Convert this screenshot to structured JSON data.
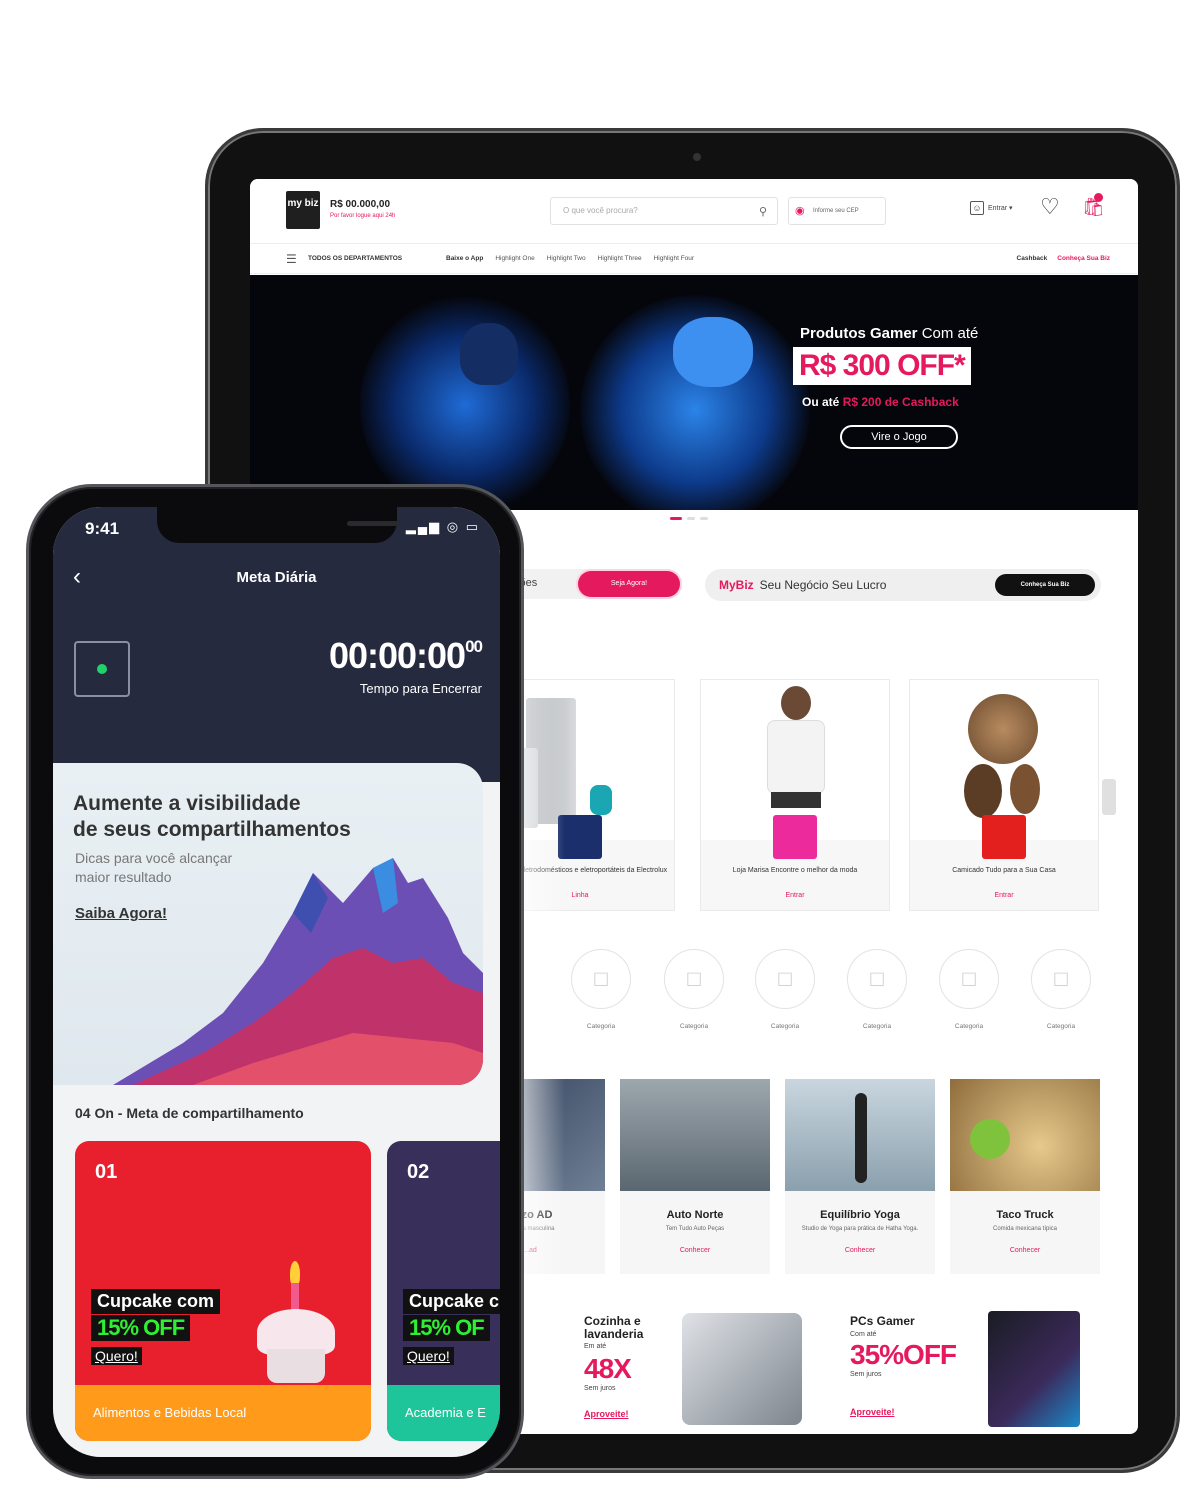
{
  "tablet": {
    "header": {
      "logo": "my biz",
      "balance": "R$ 00.000,00",
      "balance_sub": "Por favor logue aqui 24h",
      "search_placeholder": "O que você procura?",
      "cep": "Informe seu CEP",
      "user": "Entrar",
      "cart_count": "0"
    },
    "nav": {
      "all_departments": "TODOS OS DEPARTAMENTOS",
      "links": [
        "Baixe o App",
        "Highlight One",
        "Highlight Two",
        "Highlight Three",
        "Highlight Four"
      ],
      "right": [
        "Cashback",
        "Conheça Sua Biz"
      ]
    },
    "hero": {
      "headline_bold": "Produtos Gamer",
      "headline_rest": " Com até",
      "price": "R$ 300 OFF*",
      "sub_prefix": "Ou até ",
      "sub_highlight": "R$ 200 de Cashback",
      "cta": "Vire o Jogo"
    },
    "pills": {
      "left": "ções",
      "active": "Seja Agora!"
    },
    "promo": {
      "brand": "MyBiz",
      "text": "Seu Negócio Seu Lucro",
      "button": "Conheça Sua Biz"
    },
    "stores": [
      {
        "title": "Escolha eletrodomésticos e eletroportáteis da Electrolux",
        "link": "Linha"
      },
      {
        "title": "Loja Marisa Encontre o melhor da moda",
        "link": "Entrar"
      },
      {
        "title": "Camicado Tudo para a Sua Casa",
        "link": "Entrar"
      }
    ],
    "categories": [
      "Categoria",
      "Categoria",
      "Categoria",
      "Categoria",
      "Categoria",
      "Categoria"
    ],
    "businesses": [
      {
        "title": "Enzo AD",
        "desc": "...roupa masculina",
        "link": "...ad"
      },
      {
        "title": "Auto Norte",
        "desc": "Tem Tudo Auto Peças",
        "link": "Conhecer"
      },
      {
        "title": "Equilíbrio Yoga",
        "desc": "Studio de Yoga para prática de Hatha Yoga.",
        "link": "Conhecer"
      },
      {
        "title": "Taco Truck",
        "desc": "Comida mexicana típica",
        "link": "Conhecer"
      }
    ],
    "ads": [
      {
        "title": "Cozinha e lavanderia",
        "small": "Em até",
        "big": "48X",
        "small2": "Sem juros",
        "link": "Aproveite!"
      },
      {
        "title": "PCs Gamer",
        "small": "Com até",
        "big": "35%OFF",
        "small2": "Sem juros",
        "link": "Aproveite!"
      }
    ]
  },
  "phone": {
    "status_time": "9:41",
    "title": "Meta Diária",
    "timer": "00:00:00",
    "timer_ms": "00",
    "timer_label": "Tempo para Encerrar",
    "card": {
      "title_line1": "Aumente a visibilidade",
      "title_line2": "de seus compartilhamentos",
      "sub_line1": "Dicas para você alcançar",
      "sub_line2": "maior resultado",
      "link": "Saiba Agora!"
    },
    "section_title": "04 On - Meta de compartilhamento",
    "tiles": [
      {
        "num": "01",
        "name": "Cupcake com",
        "off": "15% OFF",
        "cta": "Quero!",
        "footer": "Alimentos e Bebidas Local"
      },
      {
        "num": "02",
        "name": "Cupcake c",
        "off": "15% OF",
        "cta": "Quero!",
        "footer": "Academia e E"
      }
    ]
  },
  "colors": {
    "accent": "#e5195e",
    "phone_header": "#262a3f",
    "tile1": "#e8202e",
    "tile2": "#38305a"
  }
}
